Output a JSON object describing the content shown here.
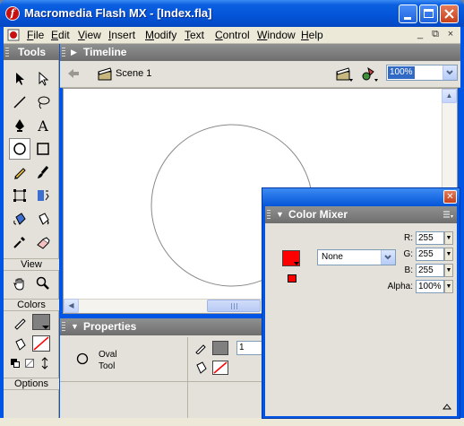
{
  "window": {
    "title": "Macromedia Flash MX - [Index.fla]",
    "icon": "flash-app-icon",
    "controls": [
      "minimize",
      "maximize",
      "close"
    ]
  },
  "menubar": {
    "items": [
      {
        "label": "File",
        "accel": "F"
      },
      {
        "label": "Edit",
        "accel": "E"
      },
      {
        "label": "View",
        "accel": "V"
      },
      {
        "label": "Insert",
        "accel": "I"
      },
      {
        "label": "Modify",
        "accel": "M"
      },
      {
        "label": "Text",
        "accel": "T"
      },
      {
        "label": "Control",
        "accel": "C"
      },
      {
        "label": "Window",
        "accel": "W"
      },
      {
        "label": "Help",
        "accel": "H"
      }
    ],
    "mdi_controls": [
      "_",
      "⧉",
      "×"
    ]
  },
  "tools": {
    "title": "Tools",
    "sections": {
      "view": "View",
      "colors": "Colors",
      "options": "Options"
    },
    "selected_tool": "oval-tool",
    "text_tool_glyph": "A"
  },
  "timeline": {
    "title": "Timeline",
    "scene": "Scene 1",
    "zoom": "100%"
  },
  "properties": {
    "title": "Properties",
    "tool_name_line1": "Oval",
    "tool_name_line2": "Tool",
    "stroke_height": "1"
  },
  "color_mixer": {
    "title": "Color Mixer",
    "fill_style": "None",
    "r_label": "R:",
    "g_label": "G:",
    "b_label": "B:",
    "alpha_label": "Alpha:",
    "r": "255",
    "g": "255",
    "b": "255",
    "alpha": "100%",
    "swatch_color": "#ff0000"
  },
  "colors": {
    "title_bar": "#0454d8",
    "panel_bg": "#e3e1d9",
    "panel_header": "#7a7a7a",
    "stroke_swatch": "#808080",
    "accent_red": "#ff0000"
  }
}
